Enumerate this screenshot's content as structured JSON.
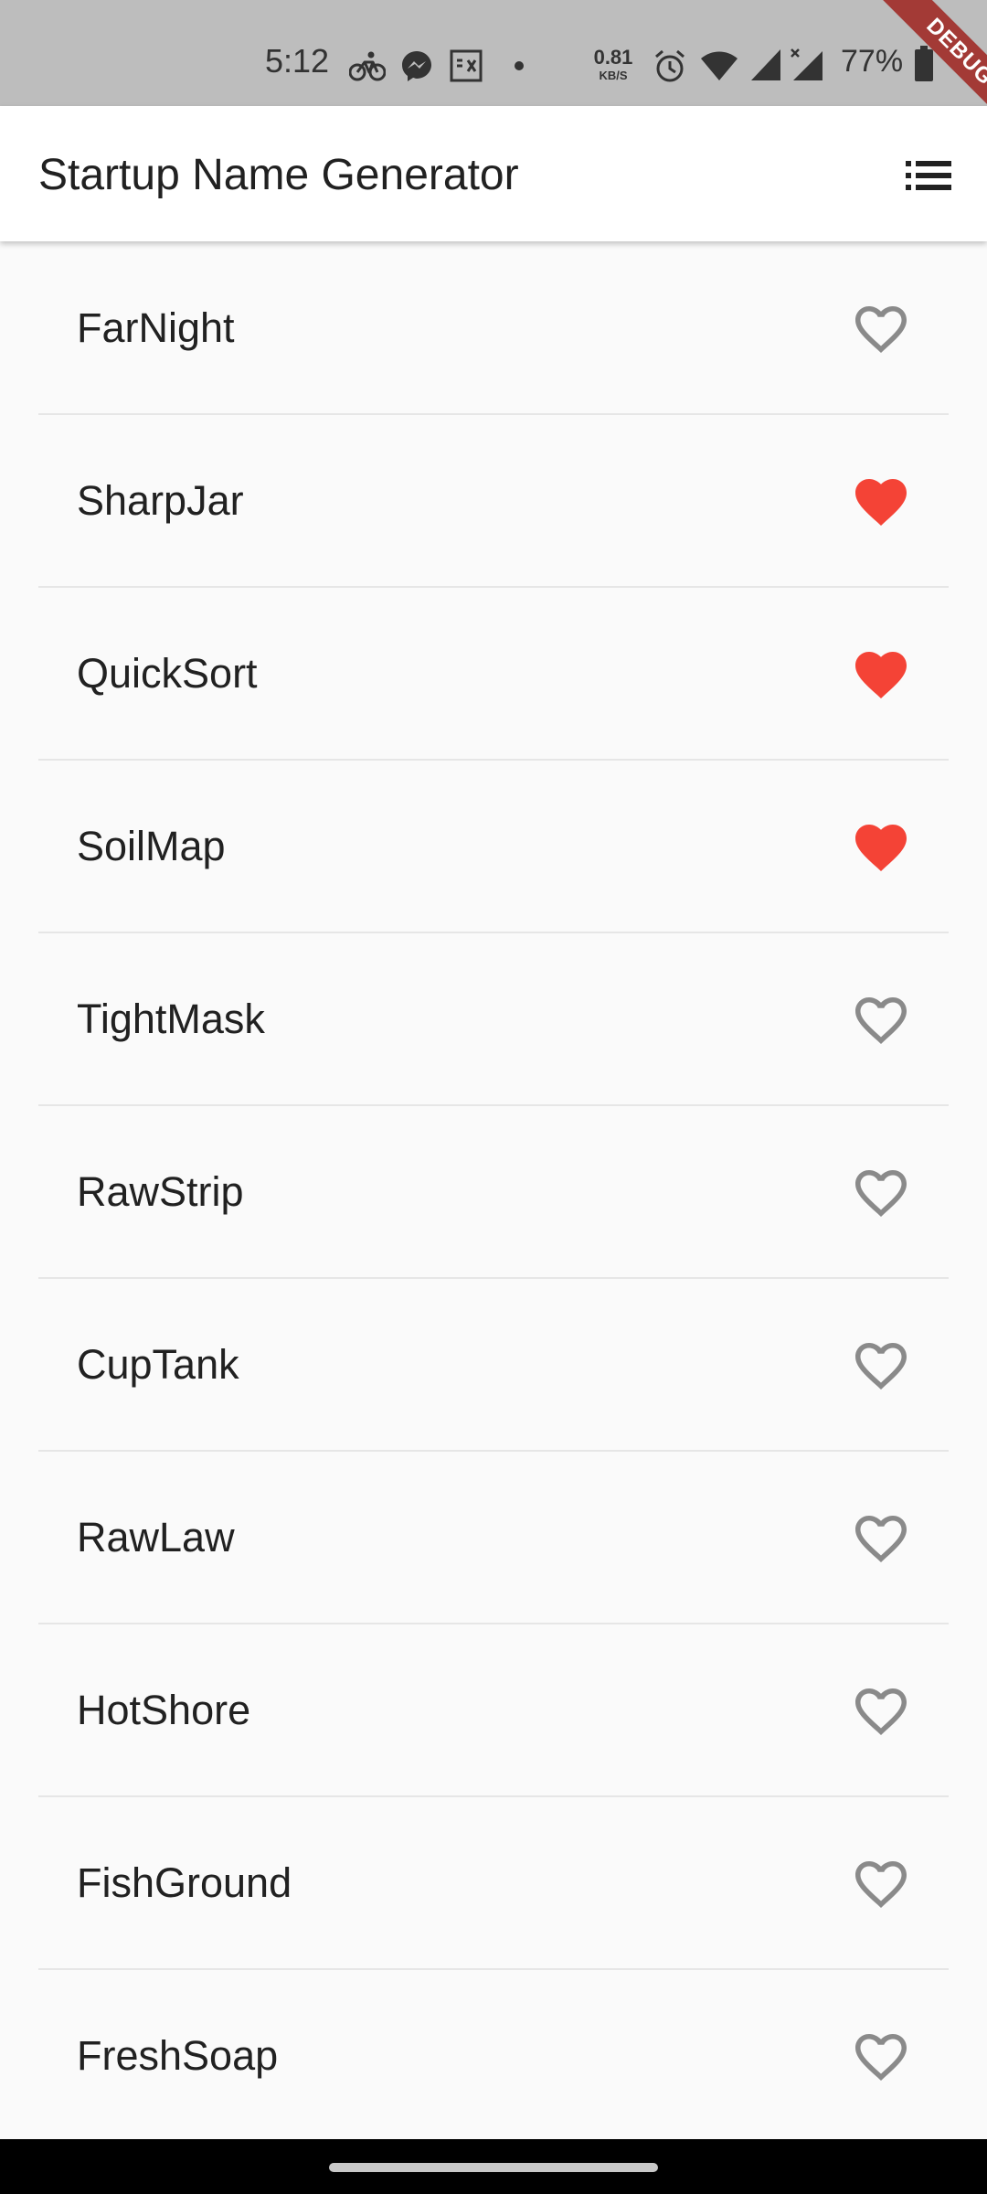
{
  "status_bar": {
    "time": "5:12",
    "net_speed_value": "0.81",
    "net_speed_unit": "KB/S",
    "battery_percent": "77%",
    "icons": [
      "bike-icon",
      "messenger-icon",
      "image-icon",
      "dot-icon",
      "alarm-icon",
      "wifi-icon",
      "signal-icon",
      "signal-x-icon",
      "battery-icon"
    ]
  },
  "debug_banner": "DEBUG",
  "app_bar": {
    "title": "Startup Name Generator",
    "action_icon": "list-icon"
  },
  "colors": {
    "favorite_heart": "#f44336",
    "outline_heart": "#8a8a8a",
    "app_bar_bg": "#ffffff",
    "list_bg": "#fafafa",
    "status_bar_bg": "#bdbdbd",
    "debug_ribbon": "#a33a36"
  },
  "items": [
    {
      "name": "FarNight",
      "favorite": false
    },
    {
      "name": "SharpJar",
      "favorite": true
    },
    {
      "name": "QuickSort",
      "favorite": true
    },
    {
      "name": "SoilMap",
      "favorite": true
    },
    {
      "name": "TightMask",
      "favorite": false
    },
    {
      "name": "RawStrip",
      "favorite": false
    },
    {
      "name": "CupTank",
      "favorite": false
    },
    {
      "name": "RawLaw",
      "favorite": false
    },
    {
      "name": "HotShore",
      "favorite": false
    },
    {
      "name": "FishGround",
      "favorite": false
    },
    {
      "name": "FreshSoap",
      "favorite": false
    }
  ]
}
